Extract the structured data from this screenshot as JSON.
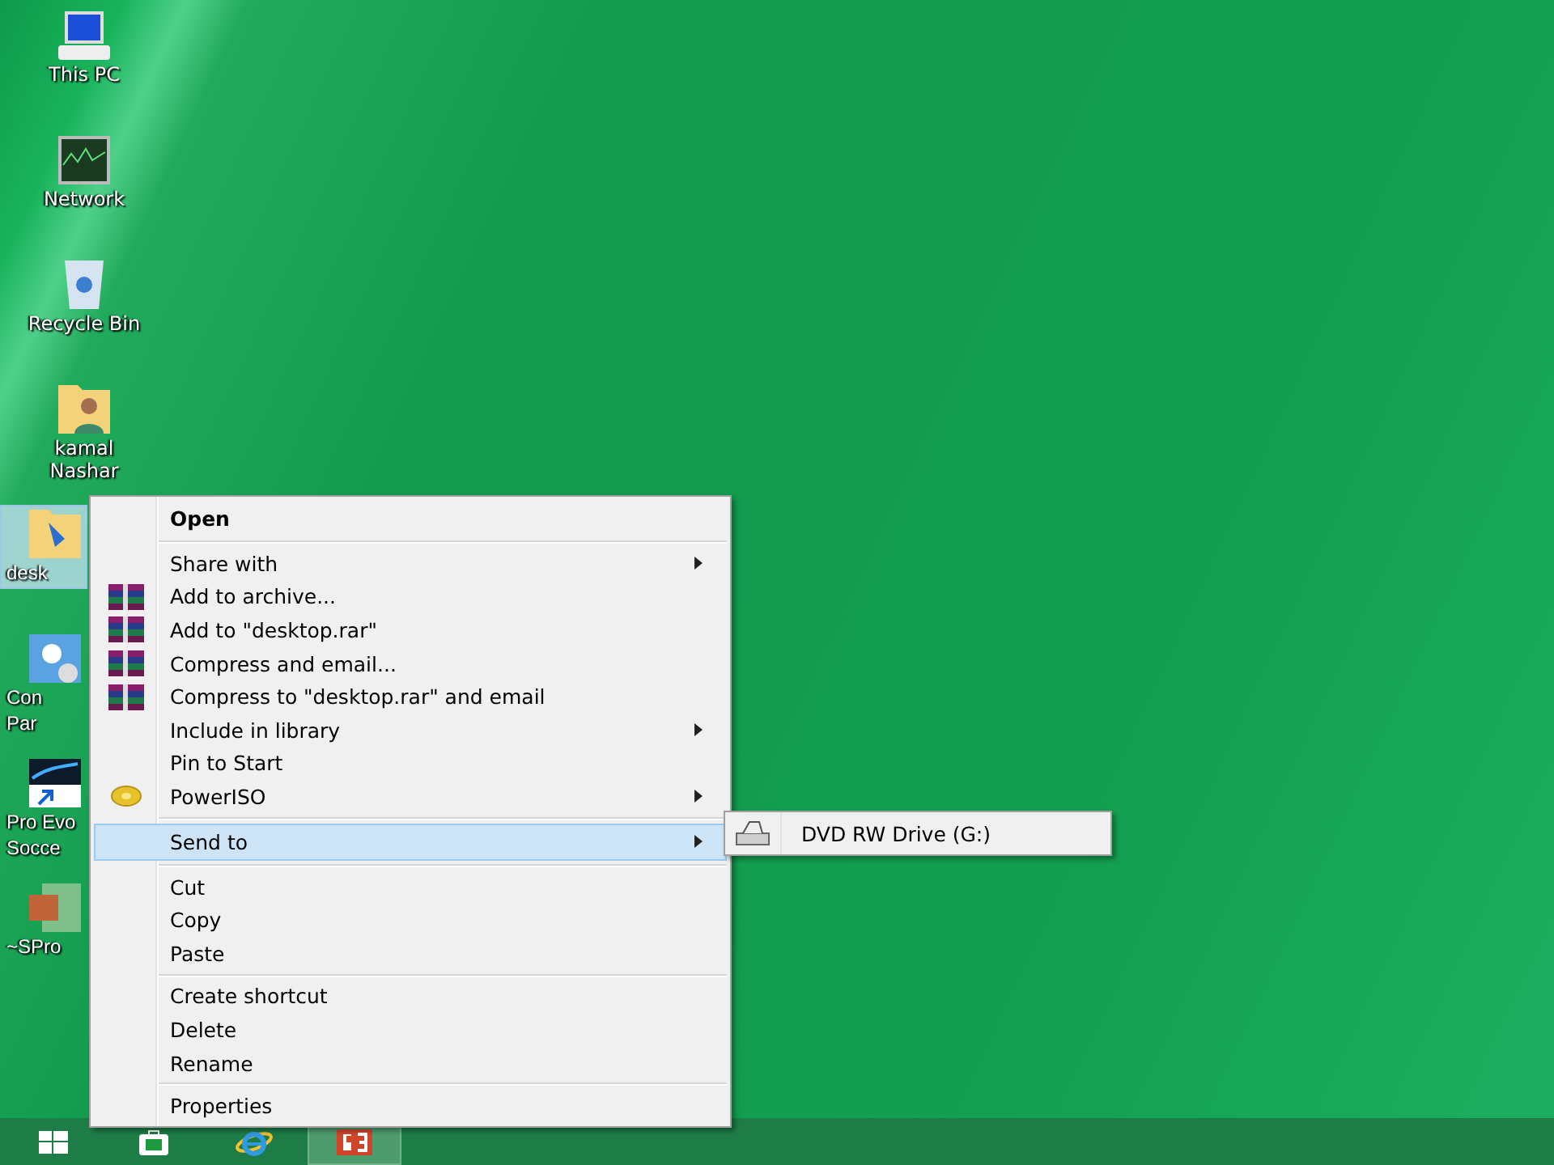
{
  "desktop_icons": [
    {
      "label": "This PC",
      "selected": false
    },
    {
      "label": "Network",
      "selected": false
    },
    {
      "label": "Recycle Bin",
      "selected": false
    },
    {
      "label": "kamal Nashar",
      "selected": false
    },
    {
      "label": "desk",
      "selected": true
    },
    {
      "label": "Con Par",
      "selected": false
    },
    {
      "label": "Pro Evo Socce",
      "selected": false
    },
    {
      "label": "~SPro",
      "selected": false
    }
  ],
  "context_menu": {
    "items": [
      {
        "kind": "item",
        "label": "Open",
        "bold": true,
        "submenu": false,
        "selected": false
      },
      {
        "kind": "separator"
      },
      {
        "kind": "item",
        "label": "Share with",
        "submenu": true,
        "selected": false
      },
      {
        "kind": "archive",
        "label": "Add to archive...",
        "submenu": false,
        "selected": false
      },
      {
        "kind": "archive",
        "label": "Add to \"desktop.rar\"",
        "submenu": false,
        "selected": false
      },
      {
        "kind": "archive",
        "label": "Compress and email...",
        "submenu": false,
        "selected": false
      },
      {
        "kind": "archive",
        "label": "Compress to \"desktop.rar\" and email",
        "submenu": false,
        "selected": false
      },
      {
        "kind": "item",
        "label": "Include in library",
        "submenu": true,
        "selected": false
      },
      {
        "kind": "item",
        "label": "Pin to Start",
        "submenu": false,
        "selected": false
      },
      {
        "kind": "disc",
        "label": "PowerISO",
        "submenu": true,
        "selected": false
      },
      {
        "kind": "separator"
      },
      {
        "kind": "item",
        "label": "Send to",
        "submenu": true,
        "selected": true
      },
      {
        "kind": "separator"
      },
      {
        "kind": "item",
        "label": "Cut",
        "submenu": false,
        "selected": false
      },
      {
        "kind": "item",
        "label": "Copy",
        "submenu": false,
        "selected": false
      },
      {
        "kind": "item",
        "label": "Paste",
        "submenu": false,
        "selected": false
      },
      {
        "kind": "separator"
      },
      {
        "kind": "item",
        "label": "Create shortcut",
        "submenu": false,
        "selected": false
      },
      {
        "kind": "item",
        "label": "Delete",
        "submenu": false,
        "selected": false
      },
      {
        "kind": "item",
        "label": "Rename",
        "submenu": false,
        "selected": false
      },
      {
        "kind": "separator"
      },
      {
        "kind": "item",
        "label": "Properties",
        "submenu": false,
        "selected": false
      }
    ]
  },
  "submenu": {
    "items": [
      {
        "label": "DVD RW Drive (G:)"
      }
    ]
  },
  "taskbar": {
    "buttons": [
      {
        "active": false
      },
      {
        "active": false
      },
      {
        "active": false
      },
      {
        "active": true
      }
    ]
  }
}
